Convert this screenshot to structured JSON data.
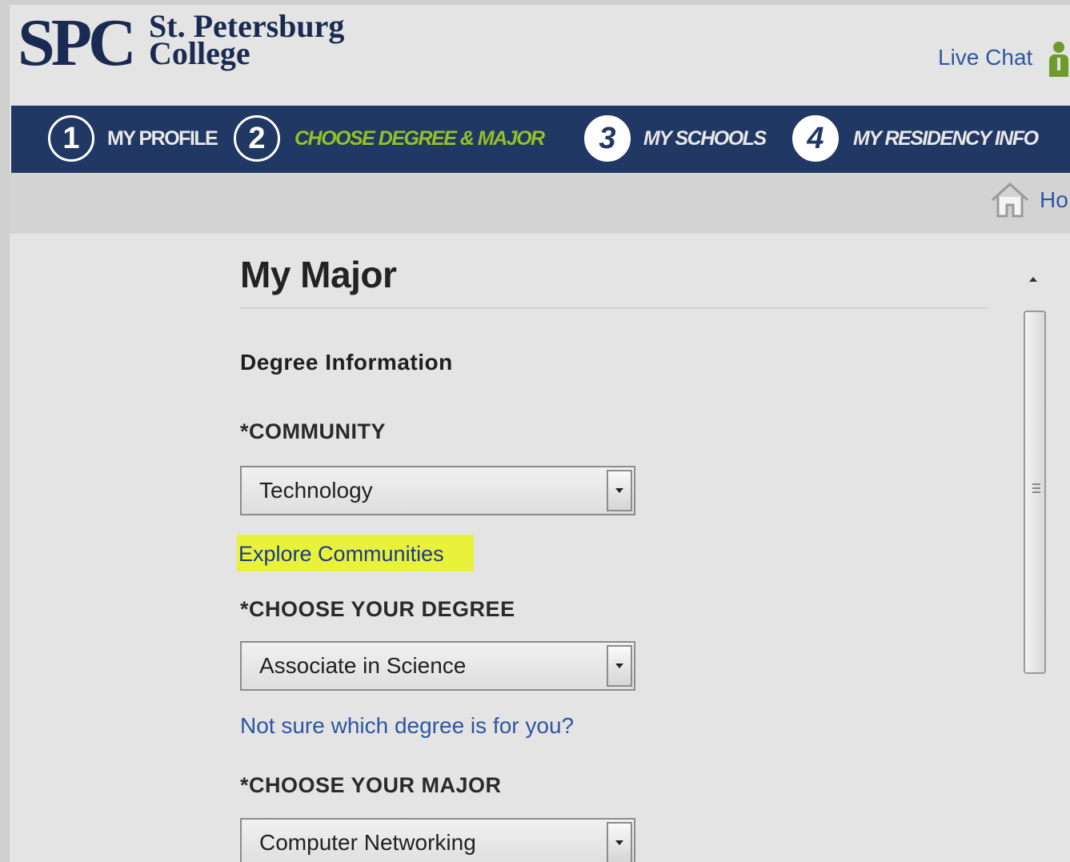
{
  "header": {
    "logo_text": "SPC",
    "college_name": "St. Petersburg College",
    "live_chat": "Live Chat"
  },
  "steps": [
    {
      "number": "1",
      "label": "MY PROFILE"
    },
    {
      "number": "2",
      "label": "CHOOSE DEGREE & MAJOR"
    },
    {
      "number": "3",
      "label": "MY SCHOOLS"
    },
    {
      "number": "4",
      "label": "MY RESIDENCY INFO"
    }
  ],
  "breadcrumb": {
    "home_label": "Ho"
  },
  "main": {
    "title": "My Major",
    "section_heading": "Degree Information",
    "community": {
      "label": "*COMMUNITY",
      "value": "Technology",
      "link": "Explore Communities"
    },
    "degree": {
      "label": "*CHOOSE YOUR DEGREE",
      "value": "Associate in Science",
      "link": "Not sure which degree is for you?"
    },
    "major": {
      "label": "*CHOOSE YOUR MAJOR",
      "value": "Computer Networking"
    }
  },
  "colors": {
    "brand_navy": "#223864",
    "active_step": "#93c126",
    "link_blue": "#2d57a3",
    "highlight": "#e8f23a"
  },
  "icons": [
    "chat-person-icon",
    "home-icon",
    "chevron-down-icon",
    "scroll-up-arrow-icon"
  ]
}
